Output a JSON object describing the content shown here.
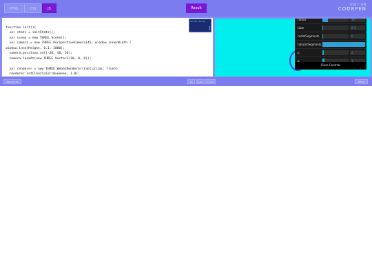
{
  "tabs": {
    "html": "HTML",
    "css": "CSS",
    "js": "JS",
    "result": "Result"
  },
  "brand": {
    "edit_on": "EDIT ON",
    "logo": "CODEPEN"
  },
  "code_lines": [
    "function init(){",
    "  var stats = initStats();",
    "  var scene = new THREE.Scene();",
    "  var camera = new THREE.PerspectiveCamera(45, window.innerWidth /",
    "window.innerHeight, 0.1, 1000);",
    "  camera.position.set(-30, 40, 50);",
    "  camera.lookAt(new THREE.Vector3(10, 0, 0));",
    "",
    "  var renderer = new THREE.WebGLRenderer({antialias: true});",
    "  renderer.setClearColor(0xeeeee, 1.0);"
  ],
  "stats": {
    "fps_label": "59 FPS (59-60)"
  },
  "gui": {
    "rows": [
      {
        "label": "radius",
        "value": "10",
        "fraction": 0.22
      },
      {
        "label": "tube",
        "value": "0.3",
        "fraction": 0.0
      },
      {
        "label": "radialSegments",
        "value": "6",
        "fraction": 0.0
      },
      {
        "label": "tubularSegments",
        "value": "",
        "fraction": 1.0
      },
      {
        "label": "p",
        "value": "2",
        "fraction": 0.05
      },
      {
        "label": "q",
        "value": "3",
        "fraction": 0.08
      }
    ],
    "close_label": "Close Controls"
  },
  "bottom": {
    "resources": "Resources",
    "btn1": "1×",
    "btn2": "0.5×",
    "btn3": "0.25×",
    "rerun": "Rerun"
  },
  "colors": {
    "accent": "#7b18d6",
    "frame": "#8a8cf5",
    "scene_bg": "#00eeee",
    "gui_fill": "#2fa1d6"
  }
}
